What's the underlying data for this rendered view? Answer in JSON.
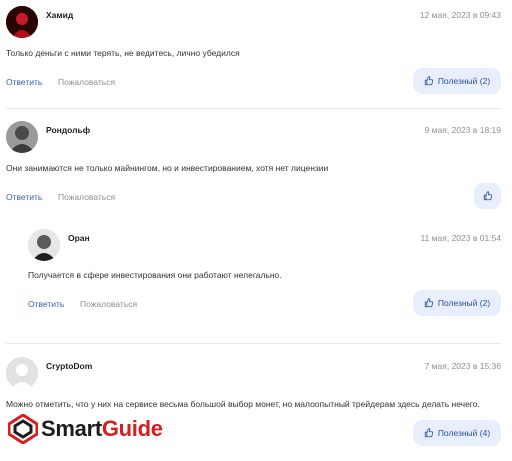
{
  "comments": [
    {
      "author": "Хамид",
      "date": "12 мая, 2023 в 09:43",
      "text": "Только деньги с ними терять, не ведитесь, лично убедился",
      "reply_label": "Ответить",
      "report_label": "Пожаловаться",
      "useful_label": "Полезный (2)"
    },
    {
      "author": "Рондольф",
      "date": "9 мая, 2023 в 18:19",
      "text": "Они занимаются не только майнингом, но и инвестированием, хотя нет лицензии",
      "reply_label": "Ответить",
      "report_label": "Пожаловаться"
    },
    {
      "author": "Оран",
      "date": "11 мая, 2023 в 01:54",
      "text": "Получается в сфере инвестирования они работают нелегально.",
      "reply_label": "Ответить",
      "report_label": "Пожаловаться",
      "useful_label": "Полезный (2)"
    },
    {
      "author": "CryptoDom",
      "date": "7 мая, 2023 в 15:36",
      "text": "Можно отметить, что у них на сервисе весьма большой выбор монет, но малоопытный трейдерам здесь делать нечего.",
      "useful_label": "Полезный (4)"
    }
  ],
  "icons": {
    "like": "thumbs-up-icon"
  },
  "colors": {
    "reply": "#3a5fb0",
    "useful_bg": "#e8eefb",
    "logo_accent": "#d71d1d"
  },
  "logo": {
    "part1": "Smart",
    "part2": "Guide"
  }
}
